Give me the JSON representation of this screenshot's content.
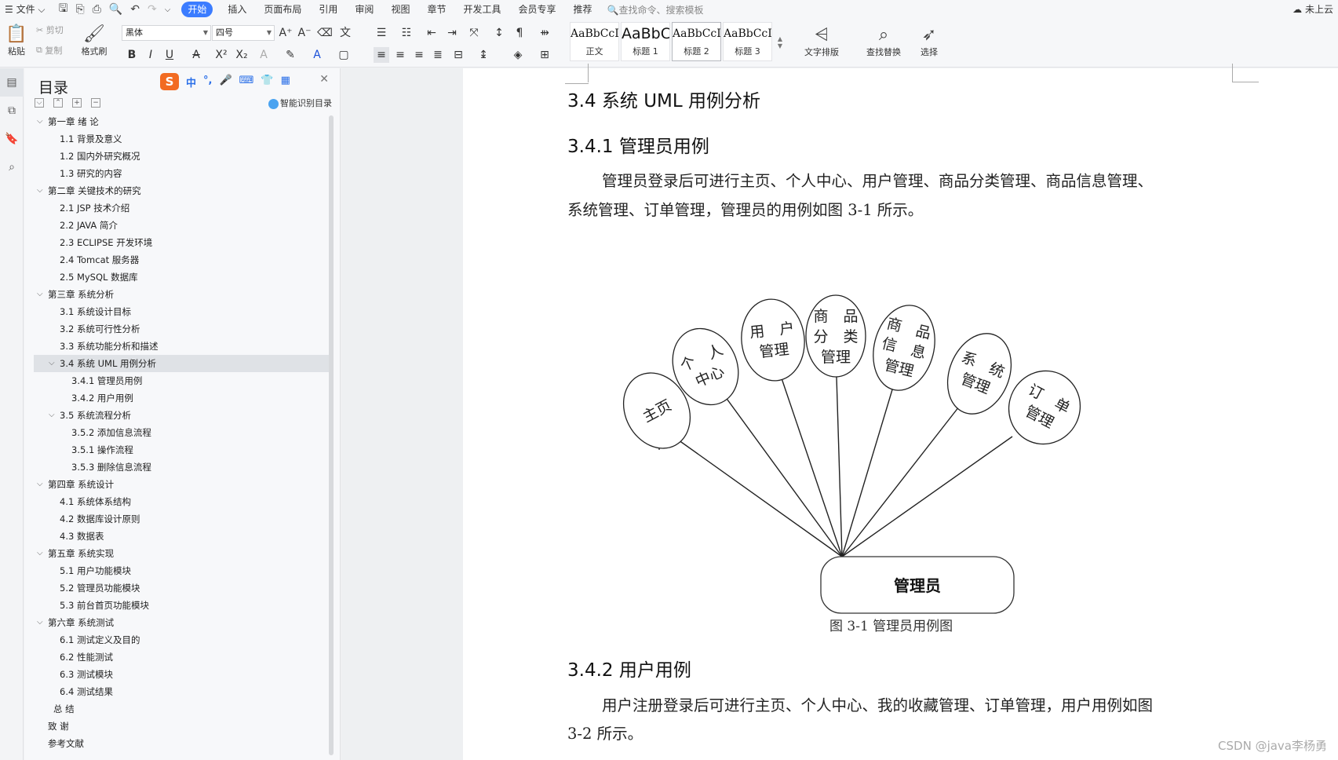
{
  "menubar": {
    "file_label": "文件",
    "items": [
      "开始",
      "插入",
      "页面布局",
      "引用",
      "审阅",
      "视图",
      "章节",
      "开发工具",
      "会员专享",
      "推荐"
    ],
    "active_index": 0,
    "search_placeholder": "查找命令、搜索模板",
    "cloud_label": "未上云"
  },
  "ribbon": {
    "paste": "粘贴",
    "cut": "剪切",
    "copy": "复制",
    "format_painter": "格式刷",
    "font_name": "黑体",
    "font_size": "四号",
    "styles": [
      {
        "sample": "AaBbCcI",
        "name": "正文"
      },
      {
        "sample": "AaBbC",
        "name": "标题 1"
      },
      {
        "sample": "AaBbCcI",
        "name": "标题 2"
      },
      {
        "sample": "AaBbCcI",
        "name": "标题 3"
      }
    ],
    "text_layout": "文字排版",
    "find_replace": "查找替换",
    "select": "选择"
  },
  "toc": {
    "title": "目录",
    "ime_labels": [
      "中",
      "°,",
      "🎤",
      "⌨",
      "👕",
      "▦"
    ],
    "smart_label": "智能识别目录",
    "items": [
      {
        "text": "第一章  绪  论",
        "level": 1,
        "expanded": true
      },
      {
        "text": "1.1 背景及意义",
        "level": 2
      },
      {
        "text": "1.2 国内外研究概况",
        "level": 2
      },
      {
        "text": "1.3  研究的内容",
        "level": 2
      },
      {
        "text": "第二章  关键技术的研究",
        "level": 1,
        "expanded": true
      },
      {
        "text": "2.1 JSP 技术介绍",
        "level": 2
      },
      {
        "text": "2.2 JAVA 简介",
        "level": 2
      },
      {
        "text": "2.3 ECLIPSE  开发环境",
        "level": 2
      },
      {
        "text": "2.4 Tomcat 服务器",
        "level": 2
      },
      {
        "text": "2.5 MySQL 数据库",
        "level": 2
      },
      {
        "text": "第三章  系统分析",
        "level": 1,
        "expanded": true
      },
      {
        "text": "3.1  系统设计目标",
        "level": 2
      },
      {
        "text": "3.2  系统可行性分析",
        "level": 2
      },
      {
        "text": "3.3  系统功能分析和描述",
        "level": 2
      },
      {
        "text": "3.4 系统 UML 用例分析",
        "level": 2,
        "expanded": true,
        "selected": true
      },
      {
        "text": "3.4.1 管理员用例",
        "level": 3
      },
      {
        "text": "3.4.2 用户用例",
        "level": 3
      },
      {
        "text": "3.5 系统流程分析",
        "level": 2,
        "expanded": true
      },
      {
        "text": "3.5.2 添加信息流程",
        "level": 3
      },
      {
        "text": "3.5.1 操作流程",
        "level": 3
      },
      {
        "text": "3.5.3 删除信息流程",
        "level": 3
      },
      {
        "text": "第四章  系统设计",
        "level": 1,
        "expanded": true
      },
      {
        "text": "4.1  系统体系结构",
        "level": 2
      },
      {
        "text": "4.2  数据库设计原则",
        "level": 2
      },
      {
        "text": "4.3  数据表",
        "level": 2
      },
      {
        "text": "第五章  系统实现",
        "level": 1,
        "expanded": true
      },
      {
        "text": "5.1 用户功能模块",
        "level": 2
      },
      {
        "text": "5.2 管理员功能模块",
        "level": 2
      },
      {
        "text": "5.3 前台首页功能模块",
        "level": 2
      },
      {
        "text": "第六章    系统测试",
        "level": 1,
        "expanded": true
      },
      {
        "text": "6.1 测试定义及目的",
        "level": 2
      },
      {
        "text": "6.2 性能测试",
        "level": 2
      },
      {
        "text": "6.3 测试模块",
        "level": 2
      },
      {
        "text": "6.4 测试结果",
        "level": 2
      },
      {
        "text": "总   结",
        "level": 1.5
      },
      {
        "text": "致   谢",
        "level": 1
      },
      {
        "text": "参考文献",
        "level": 1
      }
    ]
  },
  "document": {
    "h2": "3.4 系统 UML 用例分析",
    "h3a": "3.4.1 管理员用例",
    "para1_line1": "管理员登录后可进行主页、个人中心、用户管理、商品分类管理、商品信息管理、",
    "para1_line2": "系统管理、订单管理，管理员的用例如图 3-1 所示。",
    "figure": {
      "actor": "管理员",
      "use_cases": [
        {
          "lines": [
            "主页"
          ]
        },
        {
          "lines": [
            "个　人",
            "中心"
          ]
        },
        {
          "lines": [
            "用　户",
            "管理"
          ]
        },
        {
          "lines": [
            "商　品",
            "分　类",
            "管理"
          ]
        },
        {
          "lines": [
            "商　品",
            "信　息",
            "管理"
          ]
        },
        {
          "lines": [
            "系　统",
            "管理"
          ]
        },
        {
          "lines": [
            "订　单",
            "管理"
          ]
        }
      ],
      "caption": "图 3-1  管理员用例图"
    },
    "h3b": "3.4.2 用户用例",
    "para2_line1": "用户注册登录后可进行主页、个人中心、我的收藏管理、订单管理，用户用例如图",
    "para2_line2": "3-2 所示。"
  },
  "watermark": "CSDN @java李杨勇"
}
